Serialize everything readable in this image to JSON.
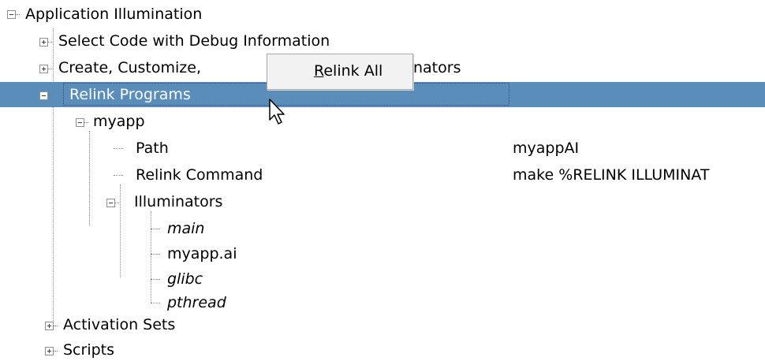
{
  "tree": {
    "root": {
      "label": "Application Illumination",
      "state": "expanded"
    },
    "children": [
      {
        "label": "Select Code with Debug Information",
        "state": "collapsed"
      },
      {
        "label": "Create, Customize,",
        "label_tail": "nators",
        "state": "collapsed"
      },
      {
        "label": "Relink Programs",
        "state": "expanded",
        "selected": true
      },
      {
        "label": "myapp",
        "state": "expanded"
      },
      {
        "label": "Path",
        "value": "myappAI"
      },
      {
        "label": "Relink Command",
        "value": "make %RELINK ILLUMINAT"
      },
      {
        "label": "Illuminators",
        "state": "expanded"
      },
      {
        "label": "main",
        "italic": true
      },
      {
        "label": "myapp.ai",
        "italic": false
      },
      {
        "label": "glibc",
        "italic": true
      },
      {
        "label": "pthread",
        "italic": true
      },
      {
        "label": "Activation Sets",
        "state": "collapsed"
      },
      {
        "label": "Scripts",
        "state": "collapsed"
      }
    ]
  },
  "context_menu": {
    "items": [
      {
        "label_mnemonic": "R",
        "label_rest": "elink All"
      }
    ]
  },
  "colors": {
    "selection": "#5b8dbb",
    "menu_background": "#f2f2f2"
  },
  "icons": {
    "cursor": "arrow-pointer-icon",
    "expand": "plus-box-icon",
    "collapse": "minus-box-icon"
  }
}
